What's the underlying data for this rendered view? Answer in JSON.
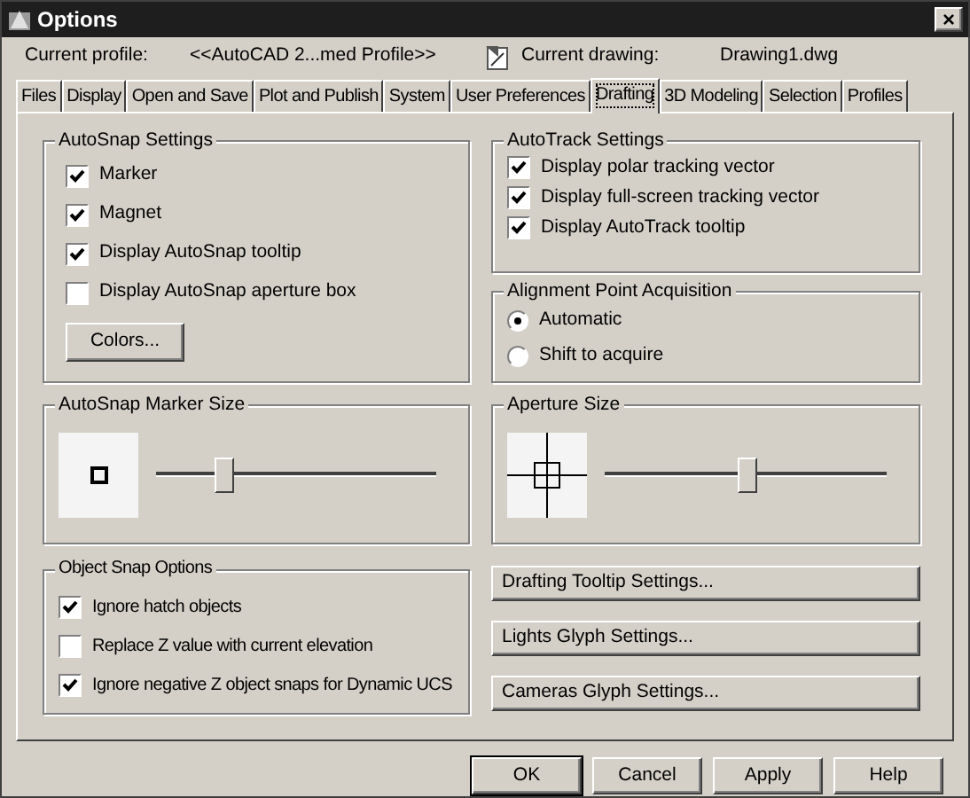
{
  "window": {
    "title": "Options",
    "close": "×"
  },
  "profile": {
    "label": "Current profile:",
    "value": "<<AutoCAD 2...med Profile>>",
    "drawing_label": "Current drawing:",
    "drawing_value": "Drawing1.dwg"
  },
  "tabs": [
    {
      "label": "Files",
      "selected": false
    },
    {
      "label": "Display",
      "selected": false
    },
    {
      "label": "Open and Save",
      "selected": false
    },
    {
      "label": "Plot and Publish",
      "selected": false
    },
    {
      "label": "System",
      "selected": false
    },
    {
      "label": "User Preferences",
      "selected": false
    },
    {
      "label": "Drafting",
      "selected": true
    },
    {
      "label": "3D Modeling",
      "selected": false
    },
    {
      "label": "Selection",
      "selected": false
    },
    {
      "label": "Profiles",
      "selected": false
    }
  ],
  "autosnap_settings": {
    "title": "AutoSnap Settings",
    "options": [
      {
        "label": "Marker",
        "checked": true
      },
      {
        "label": "Magnet",
        "checked": true
      },
      {
        "label": "Display AutoSnap tooltip",
        "checked": true
      },
      {
        "label": "Display AutoSnap aperture box",
        "checked": false
      }
    ],
    "button": "Colors..."
  },
  "autotrack_settings": {
    "title": "AutoTrack Settings",
    "options": [
      {
        "label": "Display polar tracking vector",
        "checked": true
      },
      {
        "label": "Display full-screen tracking vector",
        "checked": true
      },
      {
        "label": "Display AutoTrack tooltip",
        "checked": true
      }
    ]
  },
  "alignment_point_acquisition": {
    "title": "Alignment Point Acquisition",
    "options": [
      {
        "label": "Automatic",
        "selected": true
      },
      {
        "label": "Shift to acquire",
        "selected": false
      }
    ]
  },
  "autosnap_marker_size": {
    "title": "AutoSnap Marker Size",
    "level": 0.24
  },
  "aperture_size": {
    "title": "Aperture Size",
    "level": 0.5
  },
  "object_snap_options": {
    "title": "Object Snap Options",
    "options": [
      {
        "label": "Ignore hatch objects",
        "checked": true
      },
      {
        "label": "Replace Z value with current elevation",
        "checked": false
      },
      {
        "label": "Ignore negative Z object snaps for Dynamic UCS",
        "checked": true
      }
    ]
  },
  "side_buttons": [
    "Drafting Tooltip Settings...",
    "Lights Glyph Settings...",
    "Cameras Glyph Settings..."
  ],
  "buttons": [
    {
      "label": "OK",
      "default": true
    },
    {
      "label": "Cancel",
      "default": false
    },
    {
      "label": "Apply",
      "default": false
    },
    {
      "label": "Help",
      "default": false
    }
  ]
}
